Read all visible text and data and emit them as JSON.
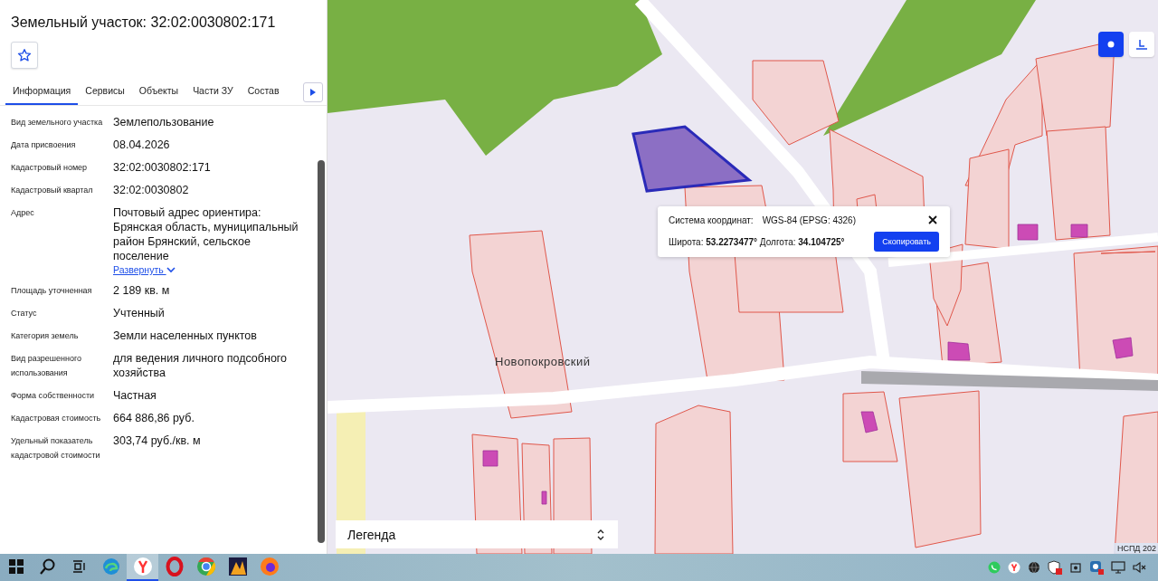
{
  "panel": {
    "title": "Земельный участок: 32:02:0030802:171",
    "favorited": false,
    "tabs": [
      {
        "label": "Информация",
        "selected": true
      },
      {
        "label": "Сервисы",
        "selected": false
      },
      {
        "label": "Объекты",
        "selected": false
      },
      {
        "label": "Части ЗУ",
        "selected": false
      },
      {
        "label": "Состав",
        "selected": false
      }
    ],
    "fields": [
      {
        "label": "Вид земельного участка",
        "value": "Землепользование"
      },
      {
        "label": "Дата присвоения",
        "value": "08.04.2026"
      },
      {
        "label": "Кадастровый номер",
        "value": "32:02:0030802:171"
      },
      {
        "label": "Кадастровый квартал",
        "value": "32:02:0030802"
      },
      {
        "label": "Адрес",
        "value": "Почтовый адрес ориентира: Брянская область, муниципальный район Брянский, сельское поселение",
        "expand_link": "Развернуть"
      },
      {
        "label": "Площадь уточненная",
        "value": "2 189 кв. м"
      },
      {
        "label": "Статус",
        "value": "Учтенный"
      },
      {
        "label": "Категория земель",
        "value": "Земли населенных пунктов"
      },
      {
        "label": "Вид разрешенного использования",
        "value": "для ведения личного подсобного хозяйства"
      },
      {
        "label": "Форма собственности",
        "value": "Частная"
      },
      {
        "label": "Кадастровая стоимость",
        "value": "664 886,86 руб."
      },
      {
        "label": "Удельный показатель кадастровой стоимости",
        "value": "303,74 руб./кв. м"
      }
    ]
  },
  "map": {
    "place_label": "Новопокровский",
    "tools": [
      {
        "kind": "point",
        "selected": true
      },
      {
        "kind": "measure",
        "selected": false
      }
    ],
    "popup": {
      "system_label": "Система координат:",
      "system_value": "WGS-84 (EPSG: 4326)",
      "coordinates": "Широта: **53.2273477°** Долгота: **34.104725°**",
      "copy_button": "Скопировать"
    },
    "legend": "Легенда",
    "attribution": "НСПД 202"
  },
  "taskbar": {
    "apps": [
      {
        "kind": "start",
        "selected": false
      },
      {
        "kind": "search",
        "selected": false
      },
      {
        "kind": "taskview",
        "selected": false
      },
      {
        "kind": "edge",
        "selected": false
      },
      {
        "kind": "yandex",
        "selected": true
      },
      {
        "kind": "opera",
        "selected": false
      },
      {
        "kind": "chrome",
        "selected": false
      },
      {
        "kind": "media",
        "selected": false
      },
      {
        "kind": "firefox",
        "selected": false
      }
    ]
  }
}
